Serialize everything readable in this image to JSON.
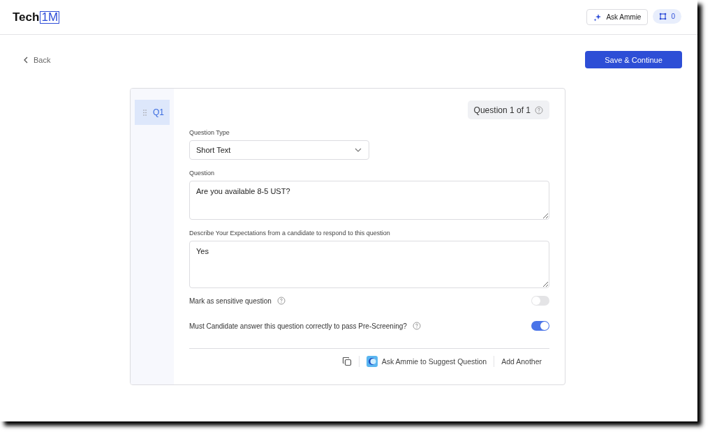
{
  "header": {
    "logo": {
      "text": "Tech",
      "badge": "1M"
    },
    "ask_button": "Ask Ammie",
    "count": "0"
  },
  "back": "Back",
  "save_button": "Save & Continue",
  "questions_nav": [
    {
      "label": "Q1",
      "selected": true
    }
  ],
  "counter": "Question 1 of 1",
  "question_type": {
    "label": "Question Type",
    "value": "Short Text"
  },
  "question": {
    "label": "Question",
    "value": "Are you available 8-5 UST?"
  },
  "expectations": {
    "label": "Describe Your Expectations from a candidate to respond to this question",
    "value": "Yes"
  },
  "toggles": [
    {
      "label": "Mark as sensitive question",
      "on": false
    },
    {
      "label": "Must Candidate answer this question correctly to pass Pre-Screening?",
      "on": true
    }
  ],
  "footer": {
    "suggest": "Ask Ammie to Suggest Question",
    "add": "Add Another"
  }
}
